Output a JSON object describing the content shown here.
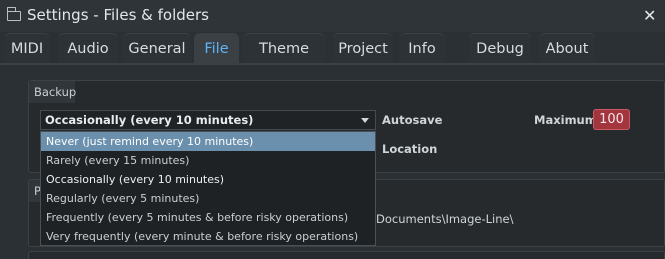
{
  "window": {
    "title": "Settings - Files & folders",
    "icon": "folder-icon",
    "close_glyph": "✕"
  },
  "tabs": [
    {
      "label": "MIDI",
      "active": false
    },
    {
      "label": "Audio",
      "active": false
    },
    {
      "label": "General",
      "active": false
    },
    {
      "label": "File",
      "active": true
    },
    {
      "label": "Theme",
      "active": false
    },
    {
      "label": "Project",
      "active": false
    },
    {
      "label": "Info",
      "active": false
    },
    {
      "label": "Debug",
      "active": false
    },
    {
      "label": "About",
      "active": false
    }
  ],
  "backup": {
    "section_label": "Backup",
    "selected": "Occasionally (every 10 minutes)",
    "options": [
      "Never (just remind every 10 minutes)",
      "Rarely (every 15 minutes)",
      "Occasionally (every 10 minutes)",
      "Regularly (every 5 minutes)",
      "Frequently (every 5 minutes & before risky operations)",
      "Very frequently (every minute & before risky operations)"
    ],
    "highlighted_option": "Never (just remind every 10 minutes)",
    "autosave_label": "Autosave",
    "maximum_label": "Maximum",
    "maximum_value": "100",
    "location_label": "Location"
  },
  "second_panel": {
    "label_partial": "Pl",
    "path_partial": "Documents\\Image-Line\\"
  },
  "colors": {
    "accent": "#5fb2f5",
    "highlight": "#6a90ad",
    "max_badge": "#a3353e"
  }
}
